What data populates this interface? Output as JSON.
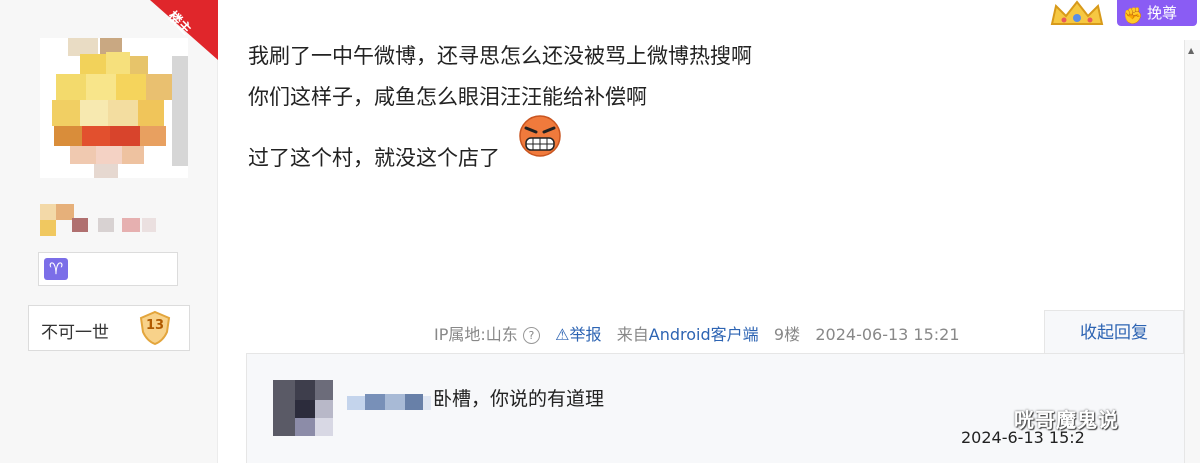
{
  "left_panel": {
    "louzhu_badge": "楼主",
    "level_title": "不可一世",
    "level_number": "13",
    "zodiac_icon": "aries-icon"
  },
  "top_right": {
    "crown_icon": "crown-icon",
    "wantop_label": "挽尊"
  },
  "post": {
    "lines": [
      "我刷了一中午微博，还寻思怎么还没被骂上微博热搜啊",
      "你们这样子，咸鱼怎么眼泪汪汪能给补偿啊",
      "过了这个村，就没这个店了"
    ],
    "emoji_icon": "angry-grin-emoji-icon"
  },
  "meta": {
    "ip": "IP属地:山东",
    "report": "举报",
    "from_prefix": "来自",
    "client": "Android客户端",
    "floor": "9楼",
    "time": "2024-06-13 15:21",
    "collapse_reply": "收起回复"
  },
  "reply": {
    "text": "卧槽，你说的有道理",
    "time": "2024-6-13 15:2"
  },
  "watermark": "咣哥魔鬼说",
  "colors": {
    "link_blue": "#2d64b3",
    "louzhu_red": "#e0262b",
    "wantop_purple": "#8a5cf4",
    "zodiac_purple": "#7b6ee8"
  }
}
